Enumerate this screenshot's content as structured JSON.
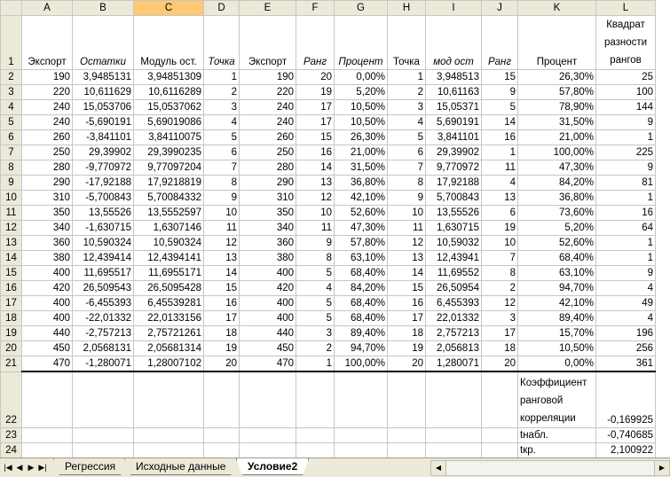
{
  "columns": [
    "A",
    "B",
    "C",
    "D",
    "E",
    "F",
    "G",
    "H",
    "I",
    "J",
    "K",
    "L"
  ],
  "selected_column": "C",
  "headers": [
    "Экспорт",
    "Остатки",
    "Модуль ост.",
    "Точка",
    "Экспорт",
    "Ранг",
    "Процент",
    "Точка",
    "мод ост",
    "Ранг",
    "Процент",
    "Квадрат разности рангов"
  ],
  "rows": [
    [
      "190",
      "3,9485131",
      "3,94851309",
      "1",
      "190",
      "20",
      "0,00%",
      "1",
      "3,948513",
      "15",
      "26,30%",
      "25"
    ],
    [
      "220",
      "10,611629",
      "10,6116289",
      "2",
      "220",
      "19",
      "5,20%",
      "2",
      "10,61163",
      "9",
      "57,80%",
      "100"
    ],
    [
      "240",
      "15,053706",
      "15,0537062",
      "3",
      "240",
      "17",
      "10,50%",
      "3",
      "15,05371",
      "5",
      "78,90%",
      "144"
    ],
    [
      "240",
      "-5,690191",
      "5,69019086",
      "4",
      "240",
      "17",
      "10,50%",
      "4",
      "5,690191",
      "14",
      "31,50%",
      "9"
    ],
    [
      "260",
      "-3,841101",
      "3,84110075",
      "5",
      "260",
      "15",
      "26,30%",
      "5",
      "3,841101",
      "16",
      "21,00%",
      "1"
    ],
    [
      "250",
      "29,39902",
      "29,3990235",
      "6",
      "250",
      "16",
      "21,00%",
      "6",
      "29,39902",
      "1",
      "100,00%",
      "225"
    ],
    [
      "280",
      "-9,770972",
      "9,77097204",
      "7",
      "280",
      "14",
      "31,50%",
      "7",
      "9,770972",
      "11",
      "47,30%",
      "9"
    ],
    [
      "290",
      "-17,92188",
      "17,9218819",
      "8",
      "290",
      "13",
      "36,80%",
      "8",
      "17,92188",
      "4",
      "84,20%",
      "81"
    ],
    [
      "310",
      "-5,700843",
      "5,70084332",
      "9",
      "310",
      "12",
      "42,10%",
      "9",
      "5,700843",
      "13",
      "36,80%",
      "1"
    ],
    [
      "350",
      "13,55526",
      "13,5552597",
      "10",
      "350",
      "10",
      "52,60%",
      "10",
      "13,55526",
      "6",
      "73,60%",
      "16"
    ],
    [
      "340",
      "-1,630715",
      "1,6307146",
      "11",
      "340",
      "11",
      "47,30%",
      "11",
      "1,630715",
      "19",
      "5,20%",
      "64"
    ],
    [
      "360",
      "10,590324",
      "10,590324",
      "12",
      "360",
      "9",
      "57,80%",
      "12",
      "10,59032",
      "10",
      "52,60%",
      "1"
    ],
    [
      "380",
      "12,439414",
      "12,4394141",
      "13",
      "380",
      "8",
      "63,10%",
      "13",
      "12,43941",
      "7",
      "68,40%",
      "1"
    ],
    [
      "400",
      "11,695517",
      "11,6955171",
      "14",
      "400",
      "5",
      "68,40%",
      "14",
      "11,69552",
      "8",
      "63,10%",
      "9"
    ],
    [
      "420",
      "26,509543",
      "26,5095428",
      "15",
      "420",
      "4",
      "84,20%",
      "15",
      "26,50954",
      "2",
      "94,70%",
      "4"
    ],
    [
      "400",
      "-6,455393",
      "6,45539281",
      "16",
      "400",
      "5",
      "68,40%",
      "16",
      "6,455393",
      "12",
      "42,10%",
      "49"
    ],
    [
      "400",
      "-22,01332",
      "22,0133156",
      "17",
      "400",
      "5",
      "68,40%",
      "17",
      "22,01332",
      "3",
      "89,40%",
      "4"
    ],
    [
      "440",
      "-2,757213",
      "2,75721261",
      "18",
      "440",
      "3",
      "89,40%",
      "18",
      "2,757213",
      "17",
      "15,70%",
      "196"
    ],
    [
      "450",
      "2,0568131",
      "2,05681314",
      "19",
      "450",
      "2",
      "94,70%",
      "19",
      "2,056813",
      "18",
      "10,50%",
      "256"
    ],
    [
      "470",
      "-1,280071",
      "1,28007102",
      "20",
      "470",
      "1",
      "100,00%",
      "20",
      "1,280071",
      "20",
      "0,00%",
      "361"
    ]
  ],
  "summary": [
    {
      "label": "Коэффициент ранговой корреляции",
      "value": "-0,169925"
    },
    {
      "label": "tнабл.",
      "value": "-0,740685"
    },
    {
      "label": "tкр.",
      "value": "2,100922"
    }
  ],
  "sheet_tabs": [
    "Регрессия",
    "Исходные данные",
    "Условие2"
  ],
  "active_tab": "Условие2",
  "nav_icons": [
    "first-sheet-icon",
    "prev-sheet-icon",
    "next-sheet-icon",
    "last-sheet-icon"
  ]
}
